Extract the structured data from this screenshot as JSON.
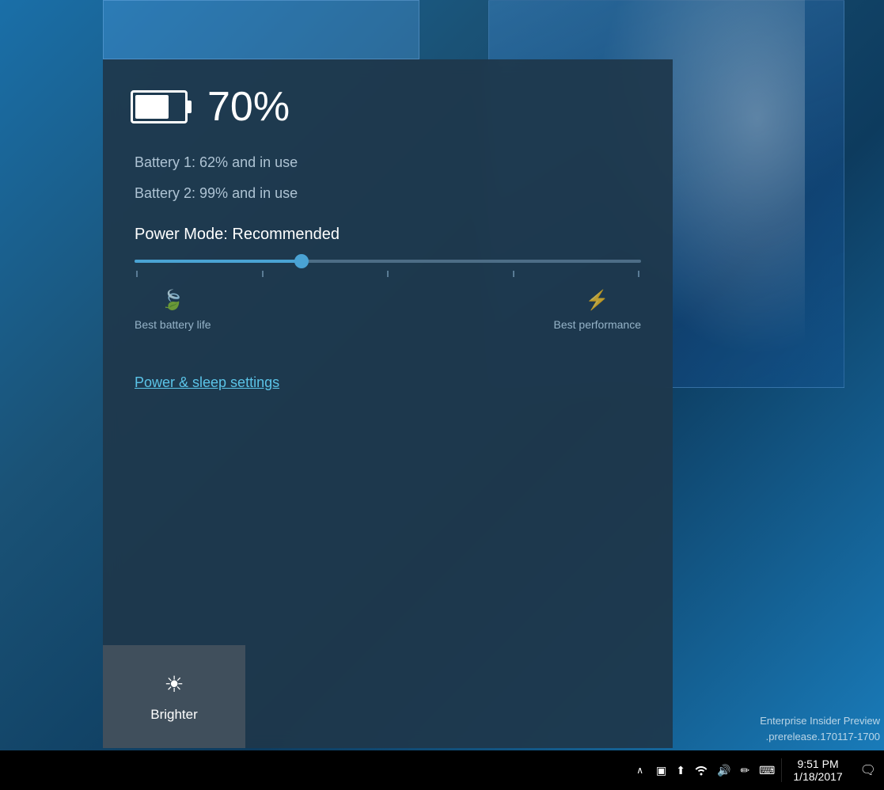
{
  "desktop": {
    "insider_line1": "Enterprise Insider Preview",
    "insider_line2": ".prerelease.170117-1700"
  },
  "battery_panel": {
    "percentage": "70%",
    "battery1": "Battery 1: 62% and in use",
    "battery2": "Battery 2: 99% and in use",
    "power_mode": "Power Mode: Recommended",
    "slider_fill_pct": 33,
    "label_left_icon": "🍃",
    "label_left_text": "Best battery life",
    "label_right_icon": "⚡",
    "label_right_text": "Best performance",
    "settings_link": "Power & sleep settings",
    "brighter_text": "Brighter"
  },
  "taskbar": {
    "time": "9:51 PM",
    "date": "1/18/2017",
    "chevron": "∧",
    "icons": [
      "▣",
      "⬆",
      "📶",
      "🔊",
      "✏",
      "⌨"
    ]
  }
}
